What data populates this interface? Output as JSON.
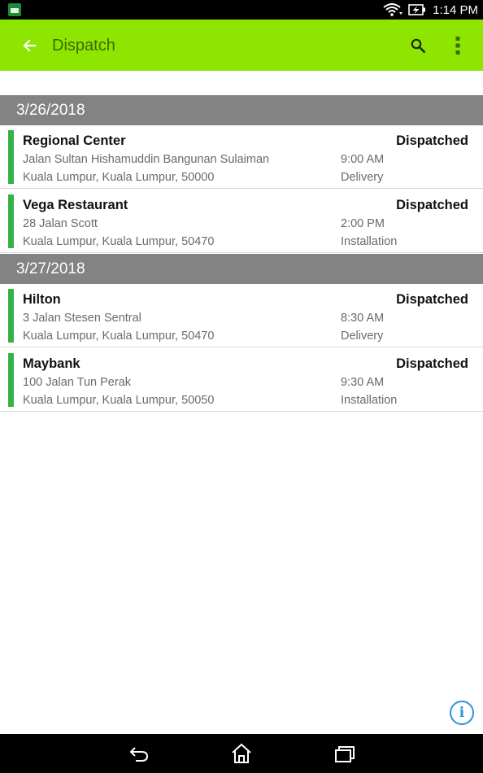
{
  "status_bar": {
    "time": "1:14 PM",
    "icons": [
      "app-notification-icon",
      "wifi-icon",
      "battery-charging-icon"
    ]
  },
  "app_bar": {
    "title": "Dispatch",
    "back_icon": "arrow-left-icon",
    "search_icon": "search-icon",
    "overflow_icon": "more-vertical-icon",
    "color": "#8ee600"
  },
  "colors": {
    "accent": "#35b34a",
    "section_header": "#838384",
    "info": "#2b95d6"
  },
  "groups": [
    {
      "date": "3/26/2018",
      "items": [
        {
          "name": "Regional Center",
          "status": "Dispatched",
          "address1": "Jalan Sultan Hishamuddin Bangunan Sulaiman",
          "address2": "Kuala Lumpur, Kuala Lumpur, 50000",
          "time": "9:00 AM",
          "type": "Delivery"
        },
        {
          "name": "Vega Restaurant",
          "status": "Dispatched",
          "address1": "28 Jalan Scott",
          "address2": "Kuala Lumpur, Kuala Lumpur, 50470",
          "time": "2:00 PM",
          "type": "Installation"
        }
      ]
    },
    {
      "date": "3/27/2018",
      "items": [
        {
          "name": "Hilton",
          "status": "Dispatched",
          "address1": "3 Jalan Stesen Sentral",
          "address2": "Kuala Lumpur, Kuala Lumpur, 50470",
          "time": "8:30 AM",
          "type": "Delivery"
        },
        {
          "name": "Maybank",
          "status": "Dispatched",
          "address1": "100 Jalan Tun Perak",
          "address2": "Kuala Lumpur, Kuala Lumpur, 50050",
          "time": "9:30 AM",
          "type": "Installation"
        }
      ]
    }
  ],
  "info_button": {
    "glyph": "i"
  },
  "nav_bar": {
    "icons": [
      "nav-back-icon",
      "nav-home-icon",
      "nav-recents-icon"
    ]
  }
}
